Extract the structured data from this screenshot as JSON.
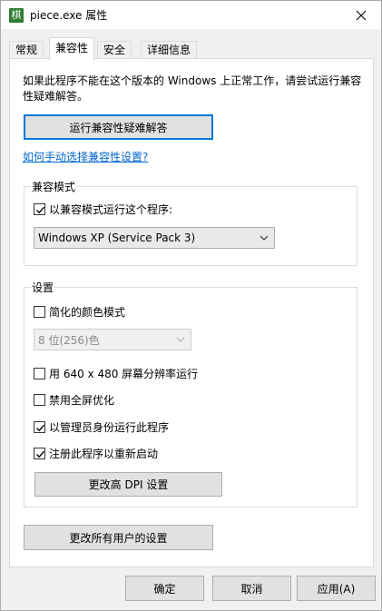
{
  "window": {
    "title": "piece.exe 属性",
    "app_icon_glyph": "棋"
  },
  "tabs": [
    {
      "label": "常规"
    },
    {
      "label": "兼容性"
    },
    {
      "label": "安全"
    },
    {
      "label": "详细信息"
    }
  ],
  "compat": {
    "description": "如果此程序不能在这个版本的 Windows 上正常工作，请尝试运行兼容性疑难解答。",
    "troubleshoot_button": "运行兼容性疑难解答",
    "manual_link": "如何手动选择兼容性设置?",
    "mode_group": {
      "label": "兼容模式",
      "checkbox_label": "以兼容模式运行这个程序:",
      "checked": true,
      "selected_os": "Windows XP (Service Pack 3)"
    },
    "settings_group": {
      "label": "设置",
      "reduced_color": {
        "label": "简化的颜色模式",
        "checked": false
      },
      "color_select": "8 位(256)色",
      "res_640": {
        "label": "用 640 x 480 屏幕分辨率运行",
        "checked": false
      },
      "disable_fullscreen": {
        "label": "禁用全屏优化",
        "checked": false
      },
      "run_as_admin": {
        "label": "以管理员身份运行此程序",
        "checked": true
      },
      "register_restart": {
        "label": "注册此程序以重新启动",
        "checked": true
      },
      "dpi_button": "更改高 DPI 设置"
    },
    "all_users_button": "更改所有用户的设置"
  },
  "footer": {
    "ok": "确定",
    "cancel": "取消",
    "apply": "应用(A)"
  },
  "colors": {
    "accent": "#0078d7",
    "link": "#0066cc"
  }
}
